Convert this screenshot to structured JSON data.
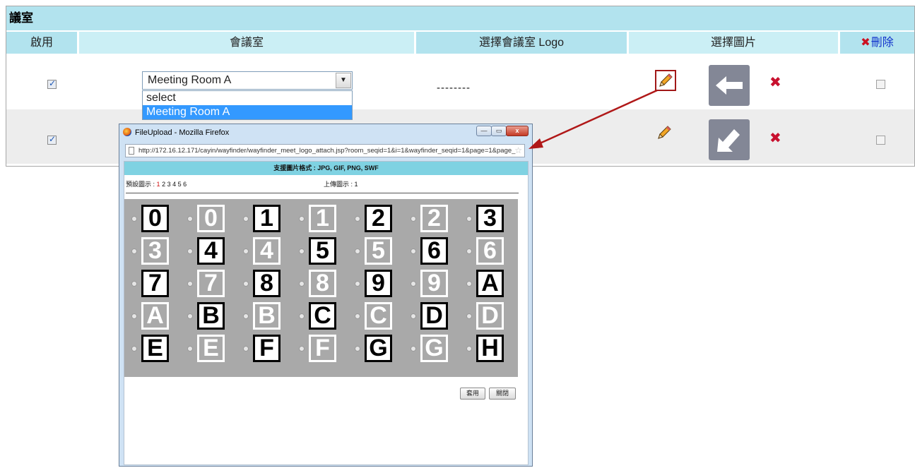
{
  "panel": {
    "title": "議室",
    "headers": {
      "enable": "啟用",
      "room": "會議室",
      "logo": "選擇會議室 Logo",
      "picture": "選擇圖片",
      "delete_mark": "✖",
      "delete": "刪除"
    },
    "rows": [
      {
        "enabled": true,
        "room_value": "Meeting Room A",
        "logo_text": "--------",
        "picture_icon": "arrow-left-icon",
        "deleted": false
      },
      {
        "enabled": true,
        "room_value": "",
        "logo_text": "",
        "picture_icon": "arrow-down-left-icon",
        "deleted": false
      }
    ],
    "dropdown_options": [
      "select",
      "Meeting Room A"
    ],
    "dropdown_selected": "Meeting Room A",
    "edit_icon": "pencil-icon",
    "remove_icon": "red-x-icon"
  },
  "popup": {
    "title": "FileUpload - Mozilla Firefox",
    "url": "http://172.16.12.171/cayin/wayfinder/wayfinder_meet_logo_attach.jsp?room_seqid=1&i=1&wayfinder_seqid=1&page=1&page_",
    "formats": "支援圖片格式 : JPG, GIF, PNG, SWF",
    "preset_label": "預設圖示 :",
    "preset_current": "1",
    "preset_pages": "2 3 4 5 6",
    "upload_label": "上傳圖示 :",
    "upload_pages": "1",
    "apply_button": "套用",
    "close_button": "關閉",
    "window_buttons": {
      "min": "—",
      "max": "▭",
      "close": "x"
    },
    "icons": [
      {
        "label": "0",
        "style": "black"
      },
      {
        "label": "0",
        "style": "white"
      },
      {
        "label": "1",
        "style": "black"
      },
      {
        "label": "1",
        "style": "white"
      },
      {
        "label": "2",
        "style": "black"
      },
      {
        "label": "2",
        "style": "white"
      },
      {
        "label": "3",
        "style": "black"
      },
      {
        "label": "3",
        "style": "white"
      },
      {
        "label": "4",
        "style": "black"
      },
      {
        "label": "4",
        "style": "white"
      },
      {
        "label": "5",
        "style": "black"
      },
      {
        "label": "5",
        "style": "white"
      },
      {
        "label": "6",
        "style": "black"
      },
      {
        "label": "6",
        "style": "white"
      },
      {
        "label": "7",
        "style": "black"
      },
      {
        "label": "7",
        "style": "white"
      },
      {
        "label": "8",
        "style": "black"
      },
      {
        "label": "8",
        "style": "white"
      },
      {
        "label": "9",
        "style": "black"
      },
      {
        "label": "9",
        "style": "white"
      },
      {
        "label": "A",
        "style": "black"
      },
      {
        "label": "A",
        "style": "white"
      },
      {
        "label": "B",
        "style": "black"
      },
      {
        "label": "B",
        "style": "white"
      },
      {
        "label": "C",
        "style": "black"
      },
      {
        "label": "C",
        "style": "white"
      },
      {
        "label": "D",
        "style": "black"
      },
      {
        "label": "D",
        "style": "white"
      },
      {
        "label": "E",
        "style": "black"
      },
      {
        "label": "E",
        "style": "white"
      },
      {
        "label": "F",
        "style": "black"
      },
      {
        "label": "F",
        "style": "white"
      },
      {
        "label": "G",
        "style": "black"
      },
      {
        "label": "G",
        "style": "white"
      },
      {
        "label": "H",
        "style": "black"
      }
    ]
  },
  "colors": {
    "header_bg": "#b2e3ee",
    "format_bar": "#7fd2e2",
    "grid_bg": "#a9a9a9",
    "highlight_red": "#a11818",
    "delete_blue": "#1133cc"
  }
}
